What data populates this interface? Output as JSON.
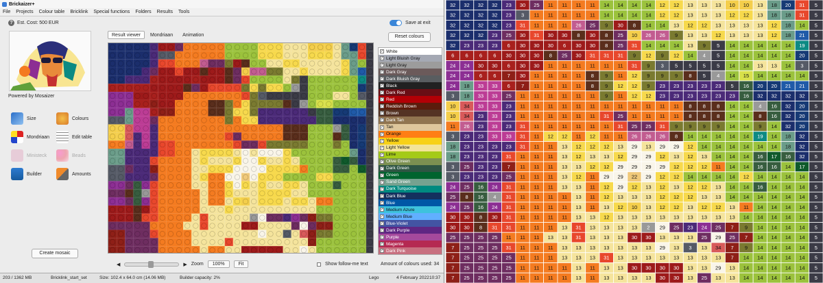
{
  "window_title": "Brickaizer+",
  "menu": [
    "File",
    "Projects",
    "Colour table",
    "Bricklink",
    "Special functions",
    "Folders",
    "Results",
    "Tools"
  ],
  "est_cost": "Est. Cost: 500 EUR",
  "powered_by": "Powered by Mosaizer",
  "side_buttons": [
    {
      "label": "Size",
      "icon": "size-icon",
      "enabled": true
    },
    {
      "label": "Colours",
      "icon": "palette-icon",
      "enabled": true
    },
    {
      "label": "Mondriaan",
      "icon": "mondriaan-icon",
      "enabled": true
    },
    {
      "label": "Edit table",
      "icon": "edit-table-icon",
      "enabled": true
    },
    {
      "label": "Ministeck",
      "icon": "ministeck-icon",
      "enabled": false
    },
    {
      "label": "Beads",
      "icon": "beads-icon",
      "enabled": false
    },
    {
      "label": "Builder",
      "icon": "builder-icon",
      "enabled": true
    },
    {
      "label": "Amounts",
      "icon": "calculator-icon",
      "enabled": true
    }
  ],
  "create_button": "Create mosaic",
  "tabs": [
    "Result viewer",
    "Mondriaan",
    "Animation"
  ],
  "active_tab": "Result viewer",
  "save_at_exit": "Save at exit",
  "reset_colours": "Reset colours",
  "colours": [
    {
      "name": "White",
      "hex": "#ffffff",
      "text": "dark"
    },
    {
      "name": "Light Bluish Gray",
      "hex": "#a5a9b4",
      "text": "dark"
    },
    {
      "name": "Light Gray",
      "hex": "#9c9c9c",
      "text": "dark"
    },
    {
      "name": "Dark Gray",
      "hex": "#6b5a5a",
      "text": "light"
    },
    {
      "name": "Dark Bluish Gray",
      "hex": "#595d60",
      "text": "light"
    },
    {
      "name": "Black",
      "hex": "#212121",
      "text": "light"
    },
    {
      "name": "Dark Red",
      "hex": "#6a0e15",
      "text": "light"
    },
    {
      "name": "Red",
      "hex": "#b30006",
      "text": "light"
    },
    {
      "name": "Reddish Brown",
      "hex": "#5b1c0c",
      "text": "light"
    },
    {
      "name": "Brown",
      "hex": "#543324",
      "text": "light"
    },
    {
      "name": "Dark Tan",
      "hex": "#907450",
      "text": "light"
    },
    {
      "name": "Tan",
      "hex": "#dec69c",
      "text": "dark"
    },
    {
      "name": "Orange",
      "hex": "#ff7e14",
      "text": "dark"
    },
    {
      "name": "Yellow",
      "hex": "#f7d117",
      "text": "dark"
    },
    {
      "name": "Light Yellow",
      "hex": "#f3e498",
      "text": "dark"
    },
    {
      "name": "Lime",
      "hex": "#a5ca18",
      "text": "dark"
    },
    {
      "name": "Olive Green",
      "hex": "#7c9051",
      "text": "light"
    },
    {
      "name": "Dark Green",
      "hex": "#2e5543",
      "text": "light"
    },
    {
      "name": "Green",
      "hex": "#00642e",
      "text": "light"
    },
    {
      "name": "Sand Green",
      "hex": "#76a290",
      "text": "light"
    },
    {
      "name": "Dark Turquoise",
      "hex": "#008a80",
      "text": "light"
    },
    {
      "name": "Dark Blue",
      "hex": "#14305e",
      "text": "light"
    },
    {
      "name": "Blue",
      "hex": "#0057a6",
      "text": "light"
    },
    {
      "name": "Medium Azure",
      "hex": "#3ec2dd",
      "text": "dark"
    },
    {
      "name": "Medium Blue",
      "hex": "#61afff",
      "text": "dark"
    },
    {
      "name": "Blue-Violet",
      "hex": "#4354a3",
      "text": "light"
    },
    {
      "name": "Dark Purple",
      "hex": "#5f2683",
      "text": "light"
    },
    {
      "name": "Purple",
      "hex": "#a5499c",
      "text": "light"
    },
    {
      "name": "Magenta",
      "hex": "#b52952",
      "text": "light"
    },
    {
      "name": "Dark Pink",
      "hex": "#c87080",
      "text": "light"
    }
  ],
  "zoom_label": "Zoom",
  "zoom_value": "100%",
  "fit_button": "Fit",
  "follow_me": "Show follow-me text",
  "amount_colours": "Amount of colours used: 34",
  "status": {
    "memory": "203 / 1362 MB",
    "project": "Bricklink_start_set",
    "size": "Size: 102.4 x 64.0 cm (14.06 MB)",
    "capacity": "Builder capacity: 2%",
    "brand": "Lego",
    "date": "4 February 2022",
    "time": "10:37"
  },
  "palette_map": {
    "3": "#555a66",
    "5": "#3b3b46",
    "6": "#a8201d",
    "7": "#8e1f17",
    "8": "#5a2e1c",
    "9": "#7a7a30",
    "10": "#f4ce4b",
    "11": "#f47b20",
    "12": "#f7d94c",
    "13": "#f5e49c",
    "14": "#9bc23c",
    "15": "#d8e04a",
    "16": "#375d3f",
    "17": "#0f5a2b",
    "18": "#6a9c89",
    "19": "#0c8a83",
    "20": "#163a75",
    "21": "#1f5aa8",
    "22": "#f0c97a",
    "23": "#4b2a78",
    "24": "#8c2e93",
    "25": "#6e2d60",
    "26": "#c25c90",
    "29": "#f9f5e9",
    "30": "#9d1a1a",
    "31": "#e8472c",
    "32": "#1b2e6c",
    "33": "#bc3c95",
    "34": "#d85a5a"
  },
  "grid_rows": [
    [
      32,
      32,
      32,
      32,
      23,
      30,
      25,
      11,
      11,
      11,
      11,
      14,
      14,
      14,
      14,
      12,
      12,
      13,
      13,
      13,
      10,
      10,
      13,
      18,
      20,
      31,
      5
    ],
    [
      32,
      32,
      32,
      32,
      23,
      3,
      11,
      11,
      11,
      11,
      11,
      14,
      14,
      14,
      14,
      12,
      12,
      13,
      13,
      13,
      12,
      12,
      13,
      18,
      18,
      31,
      5
    ],
    [
      32,
      32,
      32,
      32,
      23,
      31,
      11,
      11,
      11,
      26,
      25,
      9,
      30,
      8,
      14,
      14,
      13,
      12,
      12,
      13,
      13,
      13,
      13,
      12,
      18,
      14,
      5
    ],
    [
      32,
      32,
      32,
      23,
      25,
      30,
      31,
      30,
      30,
      8,
      30,
      8,
      25,
      10,
      26,
      26,
      9,
      13,
      13,
      12,
      13,
      13,
      13,
      12,
      18,
      21,
      5
    ],
    [
      32,
      23,
      23,
      23,
      6,
      30,
      30,
      30,
      6,
      30,
      30,
      8,
      25,
      31,
      14,
      14,
      14,
      13,
      9,
      5,
      14,
      14,
      14,
      14,
      14,
      19,
      5
    ],
    [
      6,
      6,
      6,
      6,
      30,
      30,
      30,
      8,
      25,
      30,
      31,
      31,
      31,
      9,
      12,
      9,
      12,
      14,
      4,
      5,
      14,
      14,
      14,
      14,
      14,
      20,
      5
    ],
    [
      24,
      24,
      30,
      30,
      6,
      30,
      30,
      11,
      11,
      11,
      11,
      11,
      11,
      31,
      9,
      3,
      5,
      5,
      5,
      5,
      14,
      14,
      13,
      13,
      14,
      3,
      5
    ],
    [
      24,
      24,
      6,
      6,
      7,
      30,
      11,
      11,
      11,
      11,
      8,
      9,
      11,
      12,
      9,
      9,
      9,
      8,
      5,
      4,
      14,
      15,
      14,
      14,
      14,
      14,
      5
    ],
    [
      24,
      18,
      33,
      33,
      6,
      7,
      11,
      11,
      11,
      11,
      8,
      9,
      12,
      12,
      9,
      23,
      23,
      23,
      23,
      23,
      5,
      16,
      20,
      20,
      21,
      21,
      5
    ],
    [
      3,
      18,
      33,
      33,
      25,
      11,
      11,
      11,
      11,
      11,
      11,
      9,
      11,
      12,
      12,
      23,
      23,
      23,
      23,
      23,
      23,
      16,
      32,
      32,
      32,
      32,
      5
    ],
    [
      10,
      34,
      33,
      33,
      23,
      11,
      11,
      11,
      11,
      11,
      11,
      11,
      11,
      11,
      11,
      11,
      11,
      8,
      8,
      8,
      14,
      14,
      4,
      16,
      32,
      20,
      5
    ],
    [
      10,
      34,
      23,
      33,
      23,
      11,
      11,
      11,
      11,
      11,
      11,
      31,
      25,
      11,
      11,
      11,
      11,
      8,
      8,
      8,
      14,
      14,
      8,
      16,
      32,
      20,
      5
    ],
    [
      11,
      26,
      23,
      33,
      23,
      31,
      11,
      11,
      11,
      11,
      11,
      11,
      31,
      25,
      25,
      31,
      9,
      9,
      9,
      9,
      14,
      14,
      9,
      14,
      32,
      20,
      5
    ],
    [
      3,
      23,
      23,
      33,
      33,
      31,
      11,
      12,
      12,
      11,
      12,
      11,
      11,
      26,
      26,
      26,
      8,
      14,
      14,
      14,
      14,
      14,
      19,
      14,
      18,
      32,
      5
    ],
    [
      18,
      23,
      23,
      23,
      23,
      31,
      11,
      11,
      13,
      12,
      12,
      12,
      13,
      29,
      13,
      29,
      29,
      12,
      14,
      14,
      14,
      14,
      14,
      14,
      18,
      32,
      5
    ],
    [
      18,
      23,
      23,
      23,
      31,
      11,
      11,
      11,
      13,
      12,
      13,
      13,
      12,
      29,
      29,
      12,
      13,
      12,
      13,
      14,
      14,
      14,
      16,
      17,
      16,
      32,
      5
    ],
    [
      3,
      25,
      23,
      23,
      7,
      11,
      11,
      11,
      13,
      13,
      12,
      12,
      29,
      29,
      29,
      29,
      12,
      12,
      12,
      11,
      14,
      14,
      16,
      16,
      14,
      17,
      5
    ],
    [
      3,
      23,
      23,
      23,
      25,
      11,
      11,
      11,
      13,
      12,
      11,
      29,
      29,
      22,
      29,
      12,
      12,
      14,
      14,
      14,
      14,
      12,
      14,
      14,
      14,
      14,
      5
    ],
    [
      24,
      25,
      16,
      24,
      31,
      11,
      11,
      11,
      13,
      13,
      11,
      12,
      29,
      12,
      13,
      12,
      13,
      12,
      12,
      13,
      14,
      14,
      16,
      14,
      14,
      14,
      5
    ],
    [
      25,
      8,
      16,
      4,
      31,
      11,
      11,
      11,
      11,
      13,
      11,
      12,
      13,
      13,
      13,
      12,
      12,
      12,
      13,
      13,
      14,
      14,
      14,
      14,
      14,
      14,
      5
    ],
    [
      24,
      25,
      16,
      24,
      31,
      11,
      11,
      11,
      11,
      13,
      11,
      13,
      12,
      10,
      13,
      12,
      12,
      13,
      12,
      12,
      13,
      11,
      14,
      14,
      14,
      14,
      5
    ],
    [
      30,
      30,
      8,
      30,
      31,
      11,
      11,
      11,
      11,
      13,
      13,
      12,
      13,
      13,
      13,
      13,
      13,
      13,
      13,
      13,
      13,
      14,
      14,
      14,
      14,
      14,
      5
    ],
    [
      30,
      30,
      8,
      31,
      31,
      11,
      11,
      11,
      13,
      31,
      13,
      13,
      13,
      13,
      2,
      29,
      25,
      23,
      24,
      25,
      7,
      9,
      14,
      14,
      14,
      14,
      5
    ],
    [
      25,
      25,
      25,
      25,
      11,
      11,
      11,
      13,
      13,
      31,
      13,
      13,
      13,
      30,
      30,
      13,
      13,
      13,
      25,
      29,
      25,
      7,
      14,
      14,
      14,
      14,
      5
    ],
    [
      7,
      25,
      25,
      25,
      31,
      11,
      11,
      11,
      13,
      13,
      13,
      13,
      13,
      13,
      13,
      29,
      13,
      3,
      13,
      34,
      7,
      9,
      14,
      14,
      14,
      14,
      5
    ],
    [
      7,
      25,
      25,
      25,
      25,
      11,
      11,
      11,
      13,
      13,
      13,
      31,
      13,
      13,
      13,
      13,
      13,
      13,
      13,
      13,
      7,
      14,
      14,
      14,
      14,
      14,
      5
    ],
    [
      7,
      25,
      25,
      25,
      25,
      11,
      11,
      11,
      11,
      13,
      11,
      13,
      13,
      30,
      30,
      30,
      30,
      13,
      13,
      29,
      13,
      14,
      14,
      14,
      14,
      14,
      5
    ],
    [
      7,
      25,
      25,
      25,
      25,
      11,
      11,
      11,
      11,
      13,
      11,
      13,
      13,
      13,
      13,
      30,
      30,
      13,
      25,
      13,
      13,
      14,
      14,
      14,
      14,
      14,
      5
    ]
  ]
}
